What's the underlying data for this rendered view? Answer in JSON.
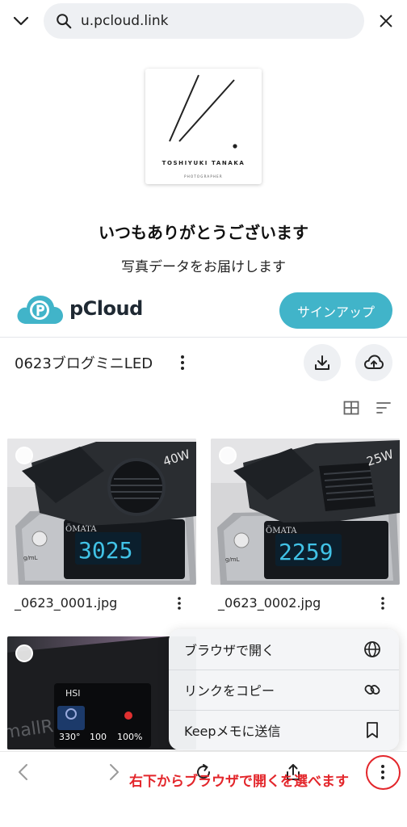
{
  "urlbar": {
    "url": "u.pcloud.link"
  },
  "logo": {
    "name": "TOSHIYUKI TANAKA",
    "subtitle": "PHOTOGRAPHER"
  },
  "greeting": "いつもありがとうございます",
  "subgreeting": "写真データをお届けします",
  "brand": {
    "name": "pCloud",
    "signup_label": "サインアップ",
    "accent_color": "#41b4c9"
  },
  "folder": {
    "title": "0623ブログミニLED"
  },
  "files": [
    {
      "name": "_0623_0001.jpg",
      "display_value": "3025",
      "badge": "40W"
    },
    {
      "name": "_0623_0002.jpg",
      "display_value": "2259",
      "badge": "25W"
    }
  ],
  "third_thumb": {
    "screen_label": "HSI",
    "readings": [
      "330°",
      "100",
      "100%"
    ]
  },
  "menu": {
    "items": [
      {
        "label": "ブラウザで開く",
        "icon": "globe-icon"
      },
      {
        "label": "リンクをコピー",
        "icon": "link-icon"
      },
      {
        "label": "Keepメモに送信",
        "icon": "bookmark-icon"
      }
    ]
  },
  "annotation": "右下からブラウザで開くを選べます",
  "annotation_color": "#e3262b"
}
